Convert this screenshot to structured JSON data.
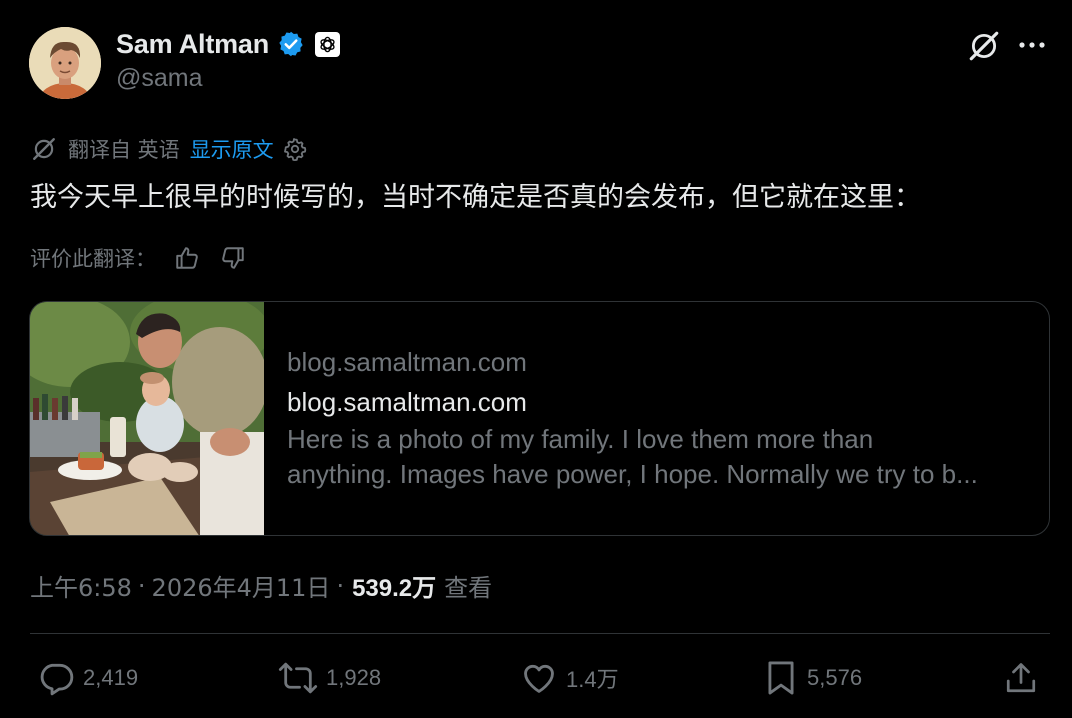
{
  "author": {
    "name": "Sam Altman",
    "handle": "@sama",
    "verified": true,
    "affiliation_icon": "openai-logo-icon"
  },
  "header_icons": [
    "grok-icon",
    "more-icon"
  ],
  "translation": {
    "meta": "翻译自 英语",
    "show_original": "显示原文",
    "settings_icon": "gear-icon"
  },
  "tweet": {
    "text": "我今天早上很早的时候写的，当时不确定是否真的会发布，但它就在这里："
  },
  "rate_translation": {
    "label": "评价此翻译："
  },
  "card": {
    "domain": "blog.samaltman.com",
    "title": "blog.samaltman.com",
    "description_line1": "Here is a photo of my family. I love them more than",
    "description_line2": "anything. Images have power, I hope. Normally we try to b..."
  },
  "meta": {
    "time": "上午6:58",
    "separator": "·",
    "date": "2026年4月11日",
    "views": "539.2万",
    "views_label": "查看"
  },
  "actions": {
    "replies": "2,419",
    "reposts": "1,928",
    "likes": "1.4万",
    "bookmarks": "5,576"
  },
  "colors": {
    "background": "#000000",
    "primary_text": "#e7e9ea",
    "secondary_text": "#71767b",
    "accent": "#1d9bf0",
    "border": "#2f3336"
  }
}
